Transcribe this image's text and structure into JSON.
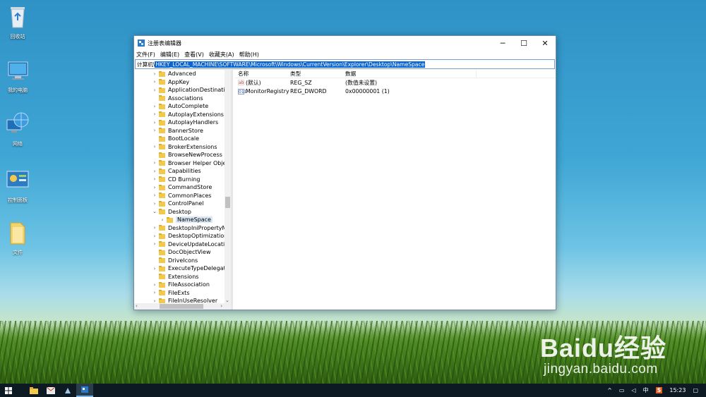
{
  "desktop": {
    "icons": [
      {
        "label": "回收站"
      },
      {
        "label": "我的电脑"
      },
      {
        "label": "网络"
      },
      {
        "label": "控制面板"
      },
      {
        "label": "文件"
      }
    ]
  },
  "window": {
    "title": "注册表编辑器",
    "menu": [
      "文件(F)",
      "编辑(E)",
      "查看(V)",
      "收藏夹(A)",
      "帮助(H)"
    ],
    "address_prefix": "计算机\\",
    "address_path": "HKEY_LOCAL_MACHINE\\SOFTWARE\\Microsoft\\Windows\\CurrentVersion\\Explorer\\Desktop\\NameSpace",
    "tree": [
      {
        "label": "Advanced",
        "expander": "›"
      },
      {
        "label": "AppKey",
        "expander": "›"
      },
      {
        "label": "ApplicationDestinatio",
        "expander": "›"
      },
      {
        "label": "Associations",
        "expander": ""
      },
      {
        "label": "AutoComplete",
        "expander": "›"
      },
      {
        "label": "AutoplayExtensions",
        "expander": "›"
      },
      {
        "label": "AutoplayHandlers",
        "expander": "›"
      },
      {
        "label": "BannerStore",
        "expander": "›"
      },
      {
        "label": "BootLocale",
        "expander": ""
      },
      {
        "label": "BrokerExtensions",
        "expander": "›"
      },
      {
        "label": "BrowseNewProcess",
        "expander": ""
      },
      {
        "label": "Browser Helper Objec",
        "expander": "›"
      },
      {
        "label": "Capabilities",
        "expander": "›"
      },
      {
        "label": "CD Burning",
        "expander": "›"
      },
      {
        "label": "CommandStore",
        "expander": "›"
      },
      {
        "label": "CommonPlaces",
        "expander": "›"
      },
      {
        "label": "ControlPanel",
        "expander": "›"
      },
      {
        "label": "Desktop",
        "expander": "⌄"
      },
      {
        "label": "NameSpace",
        "expander": "›",
        "child": true,
        "selected": true
      },
      {
        "label": "DesktopIniPropertyM",
        "expander": "›"
      },
      {
        "label": "DesktopOptimization",
        "expander": "›"
      },
      {
        "label": "DeviceUpdateLocatio",
        "expander": "›"
      },
      {
        "label": "DocObjectView",
        "expander": ""
      },
      {
        "label": "DriveIcons",
        "expander": ""
      },
      {
        "label": "ExecuteTypeDelegate",
        "expander": "›"
      },
      {
        "label": "Extensions",
        "expander": ""
      },
      {
        "label": "FileAssociation",
        "expander": "›"
      },
      {
        "label": "FileExts",
        "expander": "›"
      },
      {
        "label": "FileInUseResolver",
        "expander": "›"
      }
    ],
    "list_headers": {
      "name": "名称",
      "type": "类型",
      "data": "数据"
    },
    "values": [
      {
        "icon": "ab",
        "name": "(默认)",
        "type": "REG_SZ",
        "data": "(数值未设置)"
      },
      {
        "icon": "011",
        "name": "MonitorRegistry",
        "type": "REG_DWORD",
        "data": "0x00000001 (1)"
      }
    ]
  },
  "taskbar": {
    "tray_lang": "中",
    "tray_ime": "S",
    "clock": "15:23"
  },
  "watermark": {
    "brand": "Baidu经验",
    "url": "jingyan.baidu.com"
  },
  "colors": {
    "selection": "#0a64d2",
    "folder": "#f2c94c",
    "taskbar": "#0d1a24"
  }
}
